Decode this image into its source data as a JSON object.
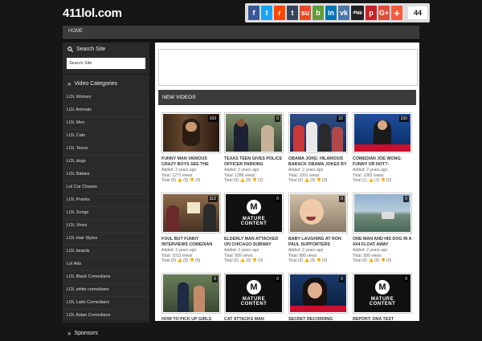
{
  "site": {
    "logo": "411lol.com"
  },
  "share": {
    "buttons": [
      {
        "icon": "facebook-icon",
        "glyph": "f",
        "color": "#3b5998"
      },
      {
        "icon": "twitter-icon",
        "glyph": "t",
        "color": "#1da1f2"
      },
      {
        "icon": "reddit-icon",
        "glyph": "r",
        "color": "#ff4500"
      },
      {
        "icon": "tumblr-icon",
        "glyph": "t",
        "color": "#35465c"
      },
      {
        "icon": "stumbleupon-icon",
        "glyph": "su",
        "color": "#eb4924"
      },
      {
        "icon": "bookmark-icon",
        "glyph": "b",
        "color": "#5e9e3a"
      },
      {
        "icon": "linkedin-icon",
        "glyph": "in",
        "color": "#0077b5"
      },
      {
        "icon": "vk-icon",
        "glyph": "vk",
        "color": "#4a76a8"
      },
      {
        "icon": "digg-icon",
        "glyph": "digg",
        "color": "#222222"
      },
      {
        "icon": "pinterest-icon",
        "glyph": "p",
        "color": "#cb2027"
      },
      {
        "icon": "googleplus-icon",
        "glyph": "G+",
        "color": "#dd4b39"
      },
      {
        "icon": "more-icon",
        "glyph": "+",
        "color": "#f65a3b"
      }
    ],
    "count": "44"
  },
  "nav": {
    "home": "HOME"
  },
  "sidebar": {
    "search_title": "Search Site",
    "search_placeholder": "Search Site",
    "categories_title": "Video Categories",
    "categories": [
      "LOL Women",
      "LOL Animals",
      "LOL Men",
      "LOL Cats",
      "LOL Teens",
      "LOL dogs",
      "LOL Babies",
      "Lol Car Chases",
      "LOL Pranks",
      "LOL Songs",
      "LOL Vines",
      "LOL Hair Styles",
      "LOL beards",
      "Lol Ads",
      "LOL Black Comedians",
      "LOL white comedians",
      "LOL Latin Comedians",
      "LOL Asian Comedians"
    ],
    "sponsors_title": "Sponsors"
  },
  "main": {
    "section_title": "NEW VIDEOS",
    "videos": [
      {
        "title": "FUNNY MAN VARIOUS CRAZY BOYS SEE THE",
        "added": "Added: 2 years ago",
        "views": "Total: 1271 views",
        "rating": "Total (0) 👍 (0) 👎 (0)",
        "count": "163",
        "thumb": "beard"
      },
      {
        "title": "TEXAS TEEN GIVES POLICE OFFICER PARKING",
        "added": "Added: 2 years ago",
        "views": "Total: 1286 views",
        "rating": "Total (0) 👍 (0) 👎 (2)",
        "count": "0",
        "thumb": "police"
      },
      {
        "title": "OBAMA JOKE: HILARIOUS BARACK OBAMA JOKES BY",
        "added": "Added: 2 years ago",
        "views": "Total: 1001 views",
        "rating": "Total (0) 👍 (0) 👎 (0)",
        "count": "22",
        "thumb": "group"
      },
      {
        "title": "COMEDIAN JOE WONG: FUNNY OR NOT?-",
        "added": "Added: 2 years ago",
        "views": "Total: 1083 views",
        "rating": "Total (1) 👍 (1) 👎 (0)",
        "count": "230",
        "thumb": "news"
      },
      {
        "title": "FOUL BUT FUNNY INTERVIEWS COMEDIAN",
        "added": "Added: 2 years ago",
        "views": "Total: 1013 views",
        "rating": "Total (0) 👍 (0) 👎 (0)",
        "count": "312",
        "thumb": "interview"
      },
      {
        "title": "ELDERLY MAN ATTACKED ON CHICAGO SUBWAY",
        "added": "Added: 2 years ago",
        "views": "Total: 909 views",
        "rating": "Total (0) 👍 (0) 👎 (0)",
        "count": "0",
        "thumb": "mature"
      },
      {
        "title": "BABY LAUGHING AT RON PAUL SUPPORTERS",
        "added": "Added: 2 years ago",
        "views": "Total: 880 views",
        "rating": "Total (0) 👍 (0) 👎 (0)",
        "count": "0",
        "thumb": "baby"
      },
      {
        "title": "ONE MAN AND HIS DOG IN A 4X4 FLOAT AWAY",
        "added": "Added: 2 years ago",
        "views": "Total: 890 views",
        "rating": "Total (0) 👍 (0) 👎 (0)",
        "count": "0",
        "thumb": "flood"
      },
      {
        "title": "HOW TO PICK UP GIRLS",
        "added": "",
        "views": "",
        "rating": "",
        "count": "0",
        "thumb": "street"
      },
      {
        "title": "CAT ATTACKS MAN",
        "added": "",
        "views": "",
        "rating": "",
        "count": "0",
        "thumb": "mature"
      },
      {
        "title": "SECRET RECORDING",
        "added": "",
        "views": "",
        "rating": "",
        "count": "0",
        "thumb": "woman"
      },
      {
        "title": "REPORT: DNA TEST",
        "added": "",
        "views": "",
        "rating": "",
        "count": "0",
        "thumb": "mature"
      }
    ],
    "mature_text": "MATURE CONTENT",
    "mature_glyph": "M"
  }
}
